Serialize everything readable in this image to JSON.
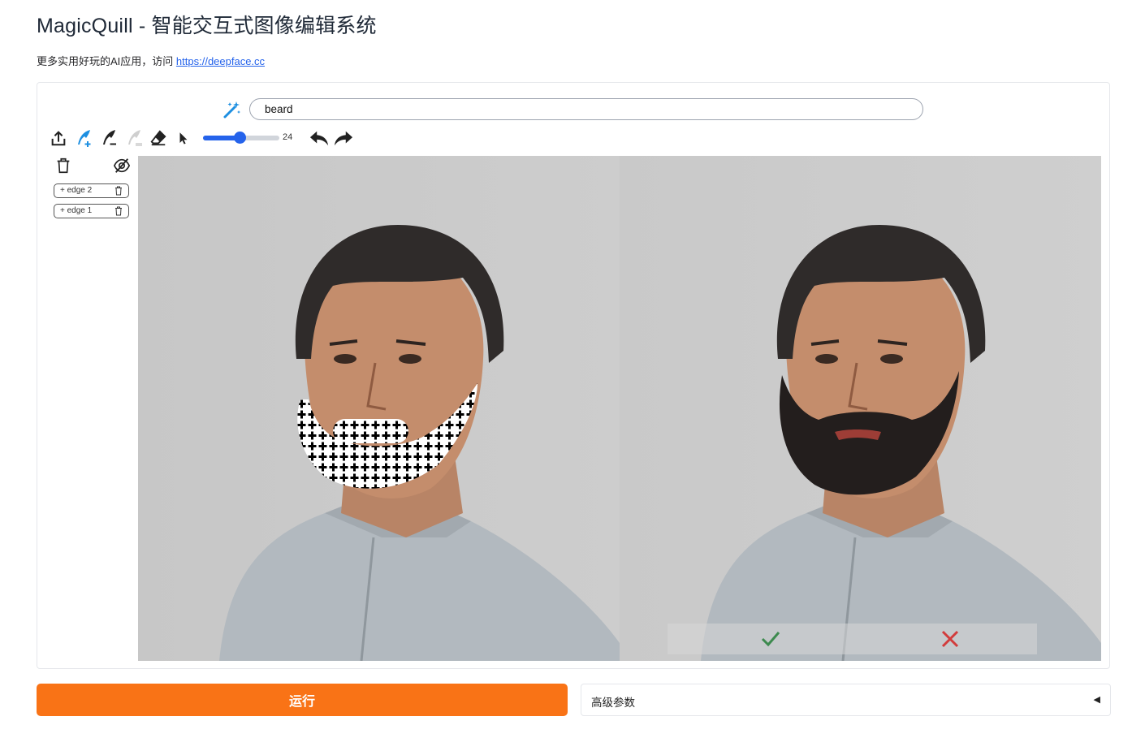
{
  "header": {
    "title": "MagicQuill - 智能交互式图像编辑系统",
    "subtitle_prefix": "更多实用好玩的AI应用，访问",
    "subtitle_link": "https://deepface.cc"
  },
  "prompt": {
    "value": "beard"
  },
  "toolbar": {
    "brush_size": "24",
    "brush_size_value": 24,
    "brush_size_max": 50,
    "accent_color": "#1d8fe1",
    "icons": [
      "upload-icon",
      "add-brush-icon",
      "subtract-brush-icon",
      "color-brush-icon",
      "eraser-icon",
      "pointer-icon",
      "undo-icon",
      "redo-icon"
    ]
  },
  "layers": [
    {
      "label": "+ edge 2"
    },
    {
      "label": "+ edge 1"
    }
  ],
  "actions": {
    "run_label": "运行",
    "advanced_label": "高级参数",
    "advanced_caret": "◀"
  },
  "colors": {
    "run_button": "#f97316",
    "accept": "#3d8a4f",
    "reject": "#d23b3b",
    "link": "#2563eb"
  }
}
